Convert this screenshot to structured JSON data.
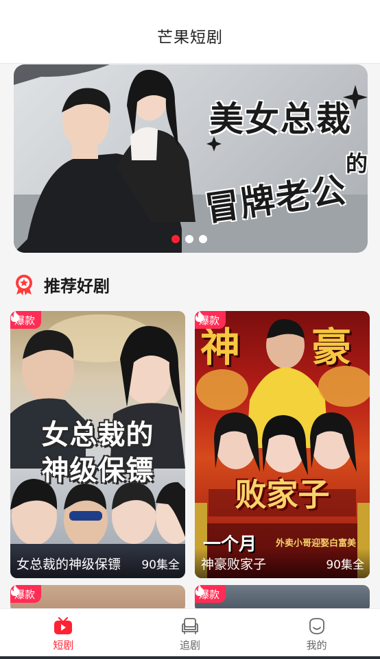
{
  "header": {
    "title": "芒果短剧"
  },
  "banner": {
    "title_line_1": "美女总裁",
    "title_de": "的",
    "title_line_2": "冒牌老公",
    "dots": 3,
    "active_dot": 0
  },
  "section": {
    "title": "推荐好剧",
    "icon": "award-ribbon-icon"
  },
  "cards": [
    {
      "badge": "爆款",
      "poster_line_1": "女总裁的",
      "poster_line_2": "神级保镖",
      "name": "女总裁的神级保镖",
      "episodes": "90集全"
    },
    {
      "badge": "爆款",
      "poster_shen": "神",
      "poster_hao": "豪",
      "poster_title": "败家子",
      "poster_yigeyue": "一个月",
      "poster_waimai": "外卖小哥迎娶白富美",
      "name": "神豪败家子",
      "episodes": "90集全"
    },
    {
      "badge": "爆款"
    },
    {
      "badge": "爆款"
    }
  ],
  "tabbar": {
    "tabs": [
      {
        "label": "短剧",
        "icon": "play-tv-icon",
        "active": true
      },
      {
        "label": "追剧",
        "icon": "sofa-tv-icon",
        "active": false
      },
      {
        "label": "我的",
        "icon": "profile-face-icon",
        "active": false
      }
    ]
  },
  "colors": {
    "accent": "#ff2233",
    "badge": "#ff2d55"
  }
}
